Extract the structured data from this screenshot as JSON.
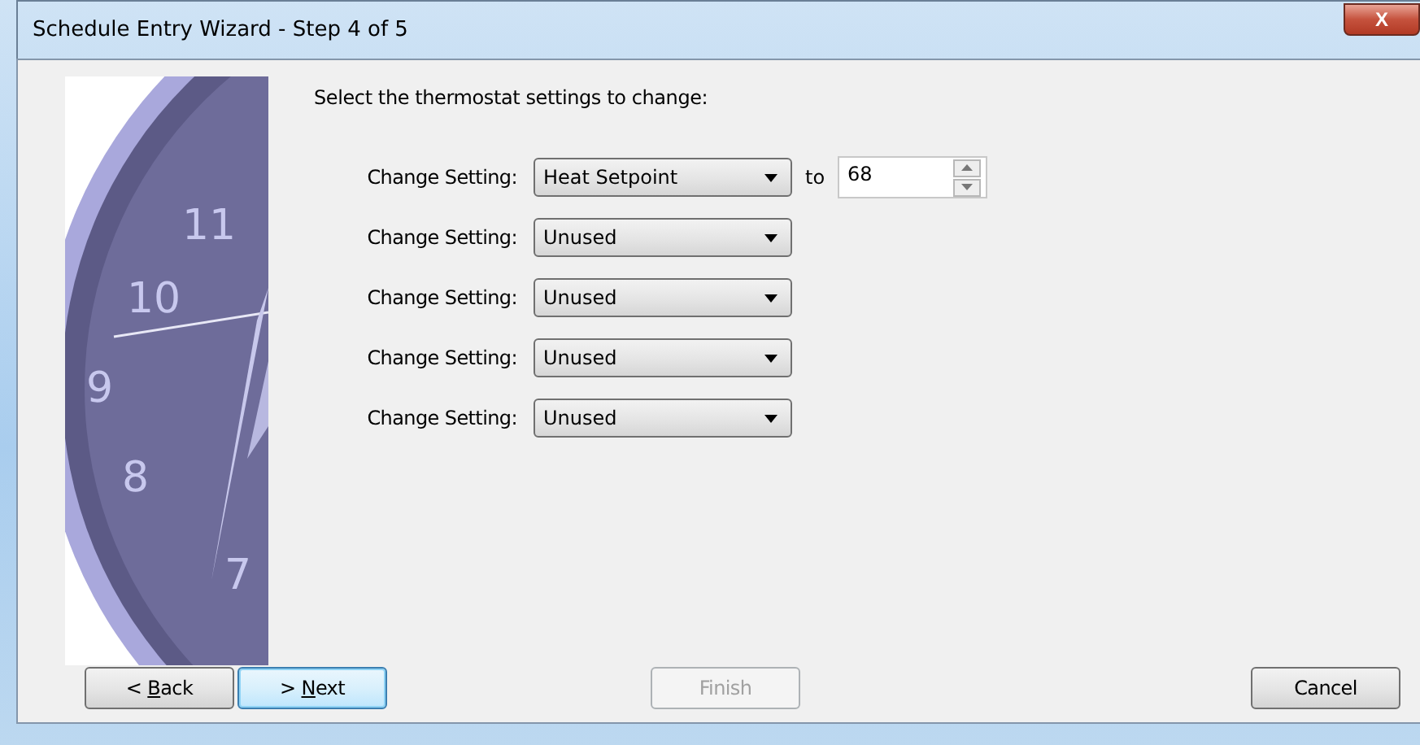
{
  "window": {
    "title": "Schedule Entry Wizard - Step 4 of 5",
    "close_button": "X"
  },
  "clock": {
    "numerals": [
      "11",
      "10",
      "9",
      "8",
      "7"
    ]
  },
  "instruction": "Select the thermostat settings to change:",
  "settings": [
    {
      "label": "Change Setting:",
      "value": "Heat Setpoint",
      "to_label": "to",
      "target": "68"
    },
    {
      "label": "Change Setting:",
      "value": "Unused"
    },
    {
      "label": "Change Setting:",
      "value": "Unused"
    },
    {
      "label": "Change Setting:",
      "value": "Unused"
    },
    {
      "label": "Change Setting:",
      "value": "Unused"
    }
  ],
  "buttons": [
    {
      "kind": "back",
      "label": "< ",
      "accel_key": "B",
      "label_after": "ack",
      "disabled": false,
      "focused": false
    },
    {
      "kind": "next",
      "label": "> ",
      "accel_key": "N",
      "label_after": "ext",
      "disabled": false,
      "focused": true
    },
    {
      "kind": "finish",
      "label": "Finish",
      "disabled": true,
      "focused": false
    },
    {
      "kind": "cancel",
      "label": "Cancel",
      "disabled": false,
      "focused": false
    }
  ]
}
